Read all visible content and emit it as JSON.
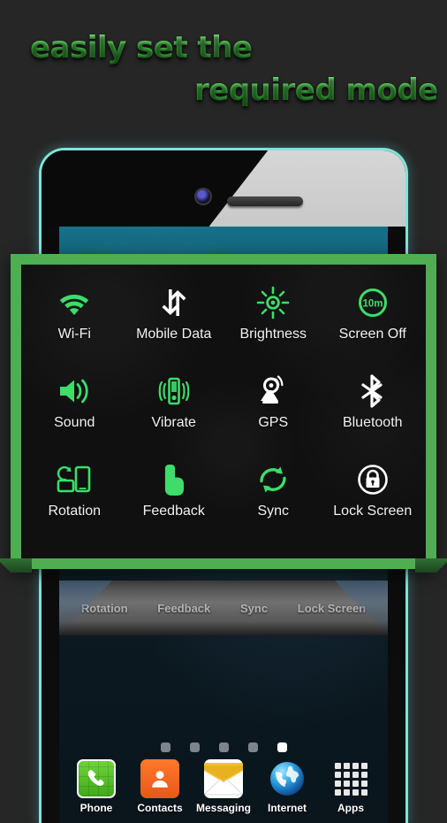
{
  "headline": {
    "line1": "easily set the",
    "line2": "required mode",
    "color": "#4ccc4c"
  },
  "theme": {
    "panel_border": "#4fae52",
    "panel_background": "#101010",
    "active_icon": "#3ddc6b",
    "inactive_icon": "#ffffff",
    "page_background": "#262626",
    "phone_edge": "#7fe3dc"
  },
  "toggle_panel": {
    "tiles": [
      {
        "label": "Wi-Fi",
        "icon": "wifi-icon",
        "state": "on"
      },
      {
        "label": "Mobile Data",
        "icon": "mobile-data-icon",
        "state": "off"
      },
      {
        "label": "Brightness",
        "icon": "brightness-icon",
        "state": "on"
      },
      {
        "label": "Screen Off",
        "icon": "screen-off-icon",
        "state": "on",
        "badge": "10m"
      },
      {
        "label": "Sound",
        "icon": "sound-icon",
        "state": "on"
      },
      {
        "label": "Vibrate",
        "icon": "vibrate-icon",
        "state": "on"
      },
      {
        "label": "GPS",
        "icon": "gps-icon",
        "state": "off"
      },
      {
        "label": "Bluetooth",
        "icon": "bluetooth-icon",
        "state": "off"
      },
      {
        "label": "Rotation",
        "icon": "rotation-icon",
        "state": "on"
      },
      {
        "label": "Feedback",
        "icon": "feedback-icon",
        "state": "on"
      },
      {
        "label": "Sync",
        "icon": "sync-icon",
        "state": "on"
      },
      {
        "label": "Lock Screen",
        "icon": "lock-screen-icon",
        "state": "off"
      }
    ]
  },
  "phone_screen": {
    "ghost_labels": [
      "Rotation",
      "Feedback",
      "Sync",
      "Lock Screen"
    ],
    "page_indicator": {
      "total": 5,
      "active": 5
    },
    "dock": [
      {
        "label": "Phone",
        "icon": "phone-icon"
      },
      {
        "label": "Contacts",
        "icon": "contacts-icon"
      },
      {
        "label": "Messaging",
        "icon": "messaging-icon"
      },
      {
        "label": "Internet",
        "icon": "internet-icon"
      },
      {
        "label": "Apps",
        "icon": "apps-grid-icon"
      }
    ]
  }
}
